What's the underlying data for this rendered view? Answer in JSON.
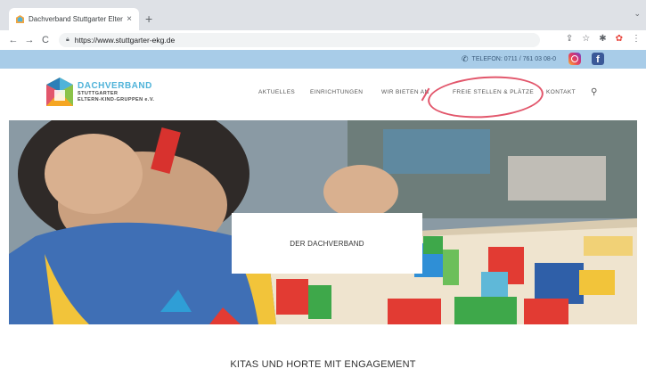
{
  "browser": {
    "tab_title": "Dachverband Stuttgarter Eltern",
    "tab_close": "×",
    "new_tab": "+",
    "url": "https://www.stuttgarter-ekg.de",
    "back": "←",
    "forward": "→",
    "reload": "C",
    "lock": "🔒"
  },
  "topbar": {
    "phone_text": "TELEFON: 0711 / 761 03 08-0",
    "phone_icon": "phone-icon",
    "facebook_letter": "f"
  },
  "logo": {
    "line1": "DACHVERBAND",
    "line2": "STUTTGARTER",
    "line3": "ELTERN-KIND-GRUPPEN e.V."
  },
  "nav": {
    "aktuelles": "AKTUELLES",
    "einrichtungen": "EINRICHTUNGEN",
    "wir_bieten": "WIR BIETEN AN",
    "freie": "FREIE STELLEN & PLÄTZE",
    "kontakt": "KONTAKT",
    "search_glyph": "⚲"
  },
  "hero": {
    "label": "DER DACHVERBAND"
  },
  "section": {
    "title": "KITAS UND HORTE MIT ENGAGEMENT"
  },
  "colors": {
    "strip": "#a8cce8",
    "annotation": "#e2566b",
    "logo_blue": "#4fb3d9"
  }
}
